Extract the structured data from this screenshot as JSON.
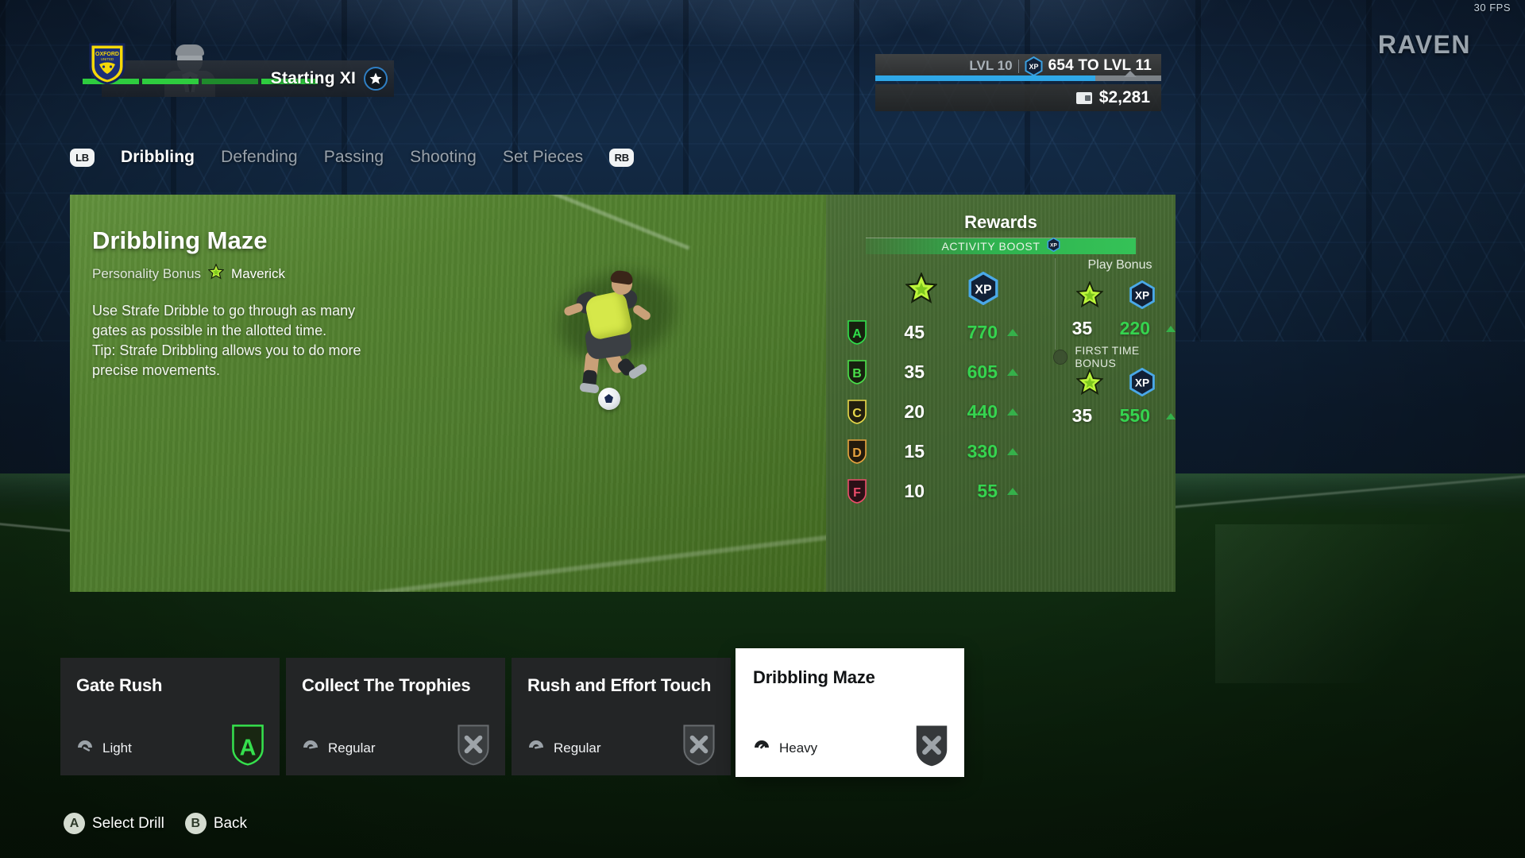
{
  "hud": {
    "fps": "30 FPS"
  },
  "club": {
    "badge_top": "OXFORD",
    "badge_bottom": "UNITED",
    "squad_label": "Starting XI",
    "star_icon": "star-icon"
  },
  "profile": {
    "name": "RAVEN",
    "level_label": "LVL 10",
    "xp_badge": "XP",
    "xp_to_next": "654 TO LVL  11",
    "coins": "$2,281",
    "wallet_icon": "wallet-icon",
    "xp_progress_percent": 77
  },
  "nav": {
    "left_bumper": "LB",
    "right_bumper": "RB",
    "tabs": [
      {
        "label": "Dribbling",
        "active": true
      },
      {
        "label": "Defending",
        "active": false
      },
      {
        "label": "Passing",
        "active": false
      },
      {
        "label": "Shooting",
        "active": false
      },
      {
        "label": "Set Pieces",
        "active": false
      }
    ]
  },
  "drill": {
    "title": "Dribbling Maze",
    "personality_label": "Personality Bonus",
    "personality_icon": "green-star-icon",
    "personality_name": "Maverick",
    "description": "Use Strafe Dribble to go through as many\ngates as possible in the allotted time.\nTip: Strafe Dribbling allows you to do more\nprecise movements."
  },
  "rewards": {
    "title": "Rewards",
    "activity_boost_label": "ACTIVITY BOOST",
    "activity_boost_badge": "XP",
    "play_bonus_label": "Play Bonus",
    "first_time_bonus_label": "FIRST TIME BONUS",
    "header_star_icon": "green-star-icon",
    "header_xp_icon": "xp-hex-icon",
    "grades": [
      {
        "grade": "A",
        "color": "#2fe04a",
        "stars": "45",
        "xp": "770"
      },
      {
        "grade": "B",
        "color": "#4ae24a",
        "stars": "35",
        "xp": "605"
      },
      {
        "grade": "C",
        "color": "#e9d84a",
        "stars": "20",
        "xp": "440"
      },
      {
        "grade": "D",
        "color": "#e8a33f",
        "stars": "15",
        "xp": "330"
      },
      {
        "grade": "F",
        "color": "#ec4d6a",
        "stars": "10",
        "xp": "55"
      }
    ],
    "play_bonus": {
      "stars": "35",
      "xp": "220"
    },
    "first_time_bonus": {
      "stars": "35",
      "xp": "550"
    }
  },
  "drill_cards": [
    {
      "title": "Gate Rush",
      "intensity": "Light",
      "grade": "A",
      "status": "graded"
    },
    {
      "title": "Collect The Trophies",
      "intensity": "Regular",
      "grade": "",
      "status": "unplayed"
    },
    {
      "title": "Rush and Effort Touch",
      "intensity": "Regular",
      "grade": "",
      "status": "unplayed"
    },
    {
      "title": "Dribbling Maze",
      "intensity": "Heavy",
      "grade": "",
      "status": "unplayed",
      "selected": true
    }
  ],
  "prompts": [
    {
      "button": "A",
      "label": "Select Drill"
    },
    {
      "button": "B",
      "label": "Back"
    }
  ]
}
